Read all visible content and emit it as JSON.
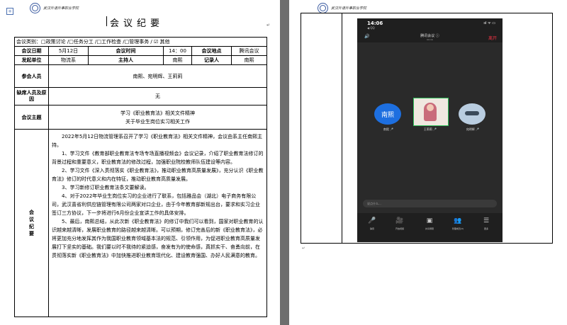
{
  "header": {
    "school_name": "武汉外语外事职业学院"
  },
  "doc": {
    "title": "会议纪要",
    "category": "会议类别：□政策讨论 /□任务分工 /□工作检查 /□管理事务 /  ☑ 其他",
    "row1": {
      "date_label": "会议日期",
      "date": "5月12日",
      "time_label": "会议时间",
      "time": "14：00",
      "place_label": "会议地点",
      "place": "腾讯会议"
    },
    "row2": {
      "dept_label": "发起单位",
      "dept": "物流系",
      "host_label": "主持人",
      "host": "南熙",
      "recorder_label": "记录人",
      "recorder": "南熙"
    },
    "attendees_label": "参会人员",
    "attendees": "南熙、宛明辉、王莉莉",
    "absent_label": "缺席人员及原因",
    "absent": "无",
    "topic_label": "会议主题",
    "topic_lines": [
      "学习《职业教育法》相关文件精神",
      "关于毕业生岗位实习相关工作"
    ],
    "minutes_label": "会议纪要",
    "minutes": [
      "2022年5月12日物流管理系召开了学习《职业教育法》相关文件精神，会议由系主任南熙主持。",
      "1、学习文件《教育部职业教育法专场专场直播视频会》会议记录，介绍了职业教育法修订的背景过程和重要意义，职业教育法的修改过程，加强职业院校教师队伍建设等内容。",
      "2、学习文件《深入贯彻落实《职业教育法》，推动职业教育高质量发展》，充分认识《职业教育法》修订的时代意义和内在特征，推动职业教育高质量发展。",
      "3、学习新修订职业教育法条文要解读。",
      "4、对于2022年毕业生岗位实习的企业进行了联系，包括雅品会（湖北）电子商务有限公司，武汉喜省利供应链管理有限公司两家对口企业，由于今年教育部新规出台，要求和实习企业签订三方协议，下一步将进行6月份企业宣讲工作的具体安排。",
      "5、最后，南熙总结，从此次新《职业教育法》的修订中我们可以看到，国家对职业教育的认识越来越清晰，发展职业教育的路径越来越清晰。可以预期，修订完善后的新《职业教育法》，必将更加充分地发挥其作为我国职业教育领域基本法的规范、引领作用，为促进职业教育高质量发展打下坚实的基础。我们要以时不我待的紧迫感，奋发有为的使命感，真抓实干、奋勇向前，在贯彻落实新《职业教育法》中加快推进职业教育现代化、建设教育强国、办好人民满意的教育。"
    ]
  },
  "phone": {
    "time": "14:06",
    "back": "◀ QQ",
    "signal": "ııl ᯤ ▭",
    "meeting_title": "腾讯会议 ⓘ",
    "meeting_time": "00:16",
    "leave_label": "离开",
    "participants": [
      {
        "avatar_text": "南熙",
        "name": "南熙 🎤"
      },
      {
        "avatar_text": "",
        "name": "王莉莉 🎤"
      },
      {
        "avatar_text": "",
        "name": "宛明辉 🎤"
      }
    ],
    "chat_placeholder": "说点什么...",
    "tools": [
      {
        "icon": "🎤",
        "label": "静音"
      },
      {
        "icon": "🎥",
        "label": "开启视频"
      },
      {
        "icon": "▣",
        "label": "共享屏幕"
      },
      {
        "icon": "👥",
        "label": "管理成员(3)"
      },
      {
        "icon": "☰",
        "label": "更多"
      }
    ]
  },
  "colors": {
    "blue_avatar": "#1d6fe0",
    "leave_red": "#ee3344",
    "active_speaker": "#2fbf5a"
  }
}
